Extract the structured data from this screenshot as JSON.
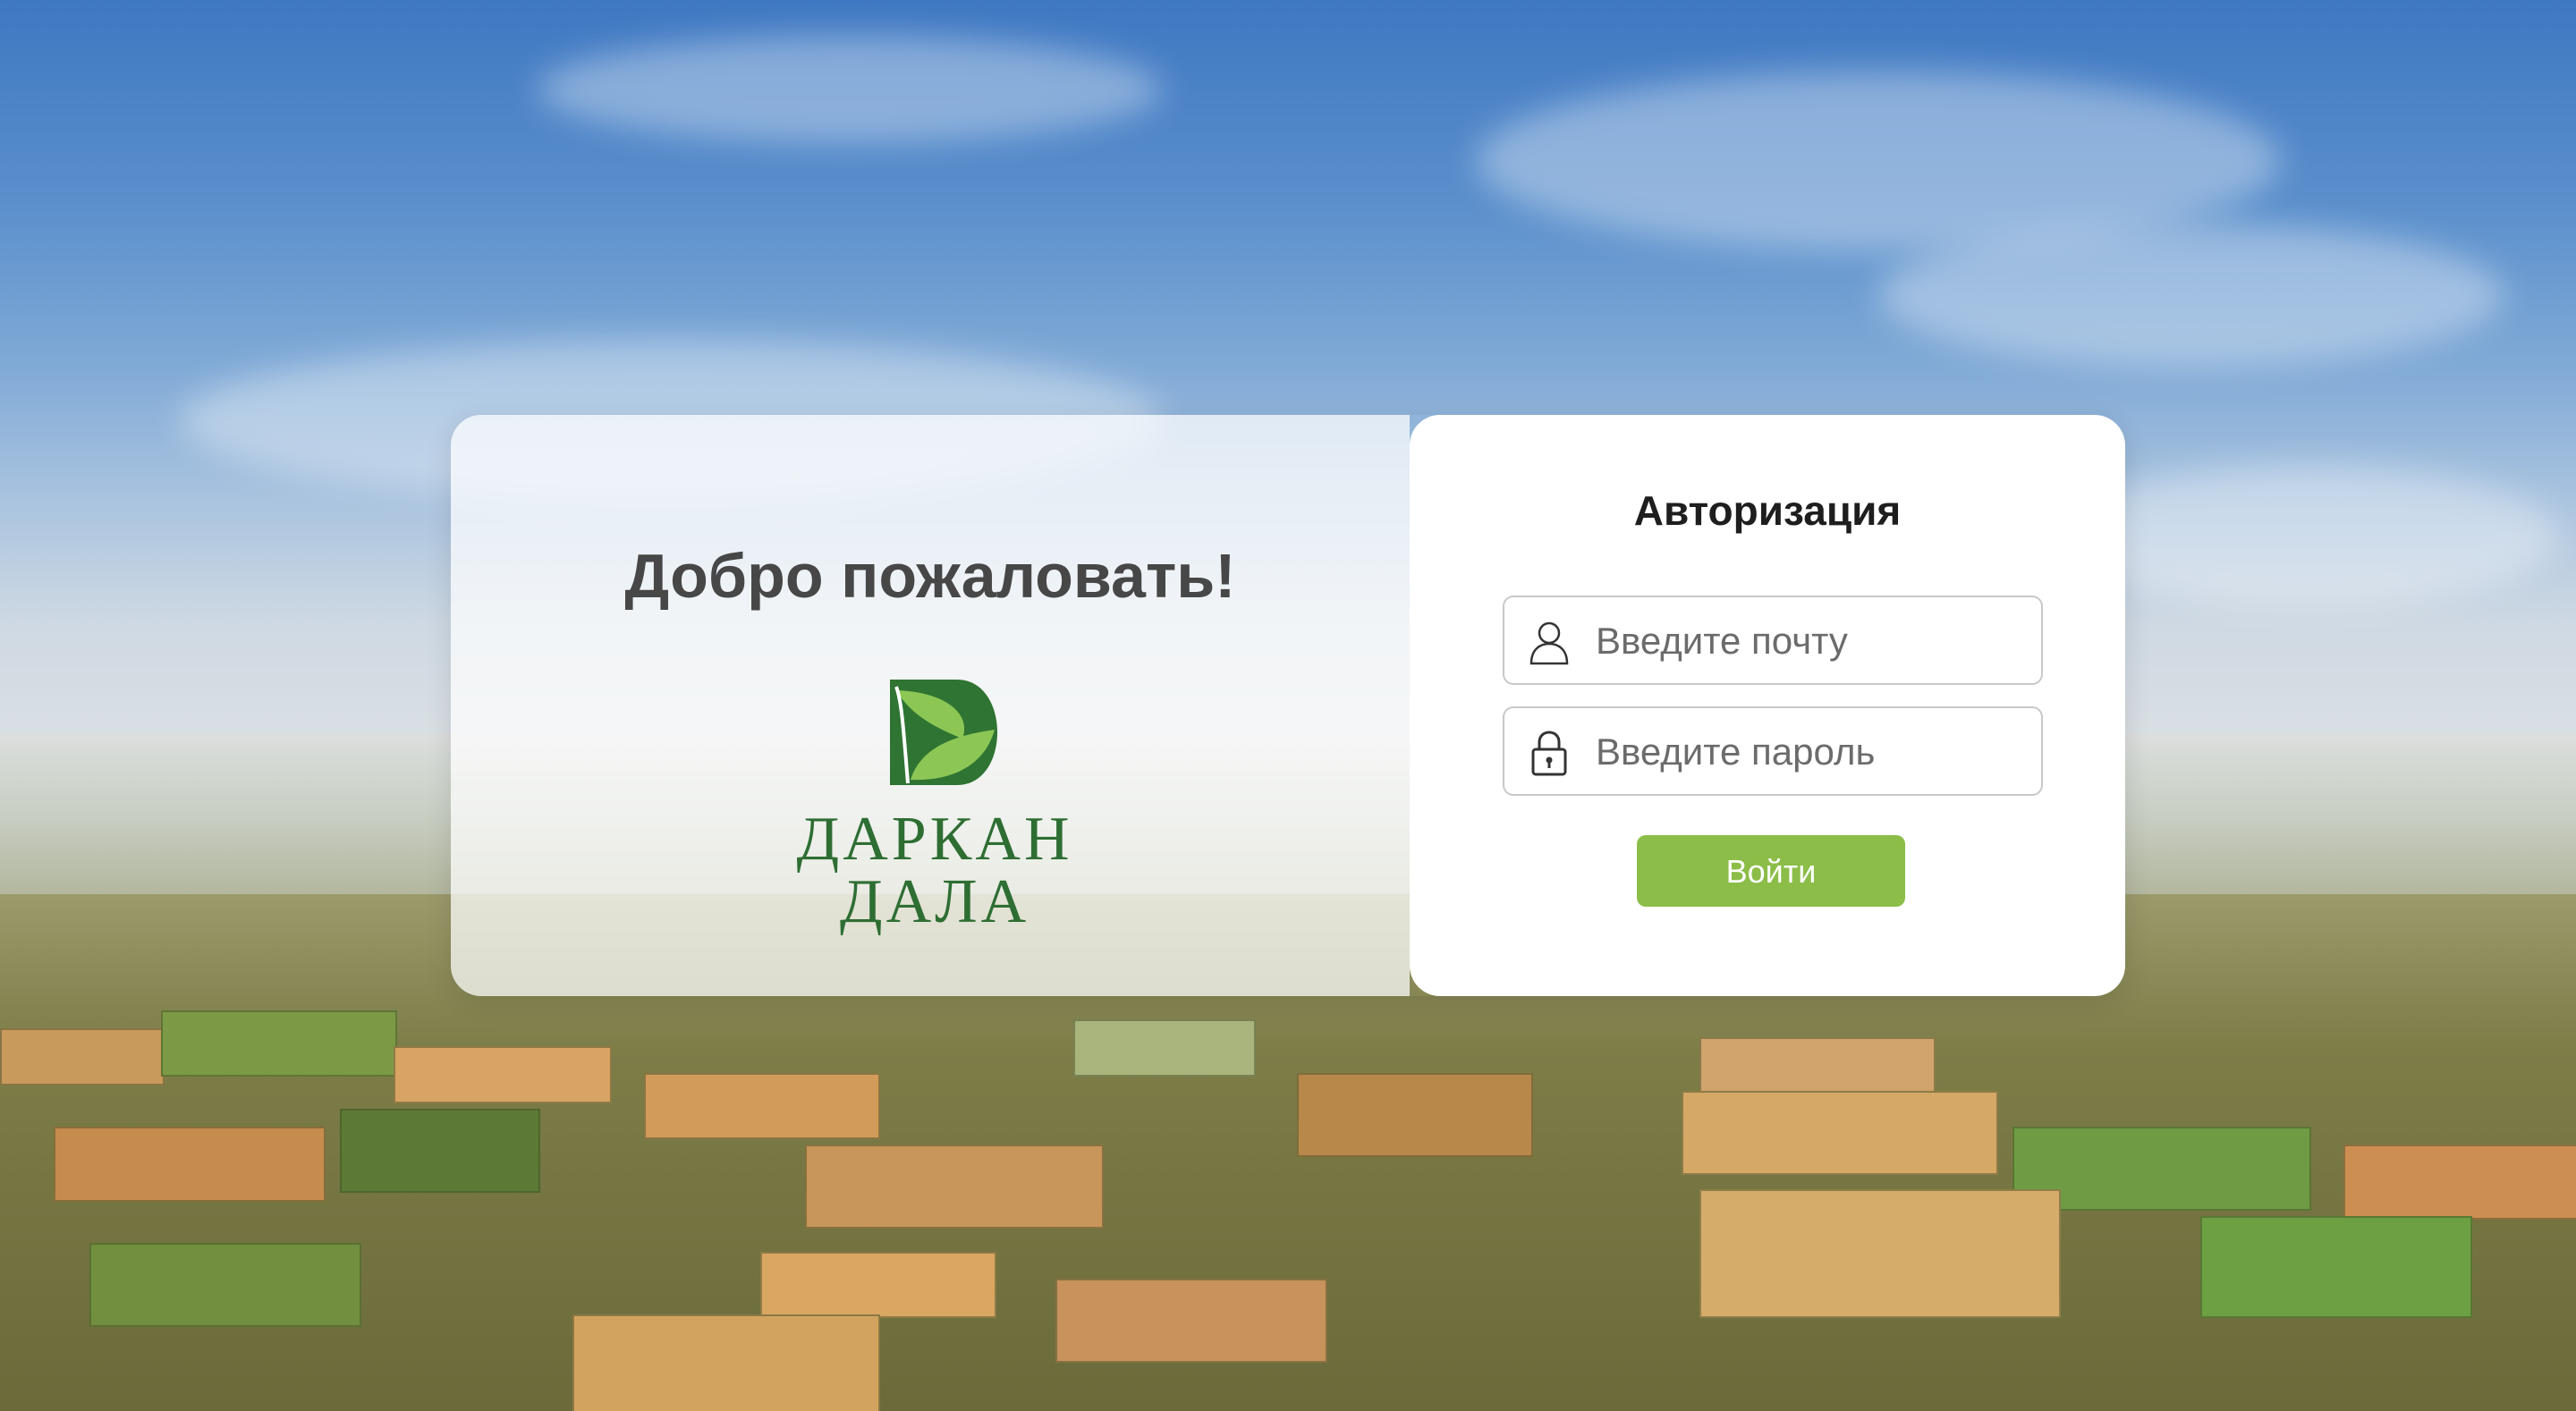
{
  "welcome": {
    "title": "Добро пожаловать!"
  },
  "logo": {
    "line1": "ДАРКАН",
    "line2": "ДАЛА",
    "colors": {
      "dark": "#2e6e33",
      "light": "#7bbd45"
    }
  },
  "auth": {
    "title": "Авторизация",
    "email_placeholder": "Введите почту",
    "email_value": "",
    "email_icon": "user-icon",
    "password_placeholder": "Введите пароль",
    "password_value": "",
    "password_icon": "lock-icon",
    "submit_label": "Войти"
  },
  "colors": {
    "accent": "#8bbd48",
    "title_text": "#474747"
  }
}
